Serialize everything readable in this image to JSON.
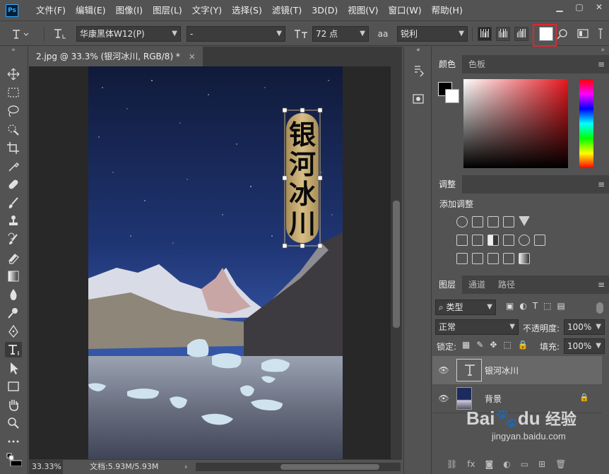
{
  "app": {
    "logo": "Ps",
    "menus": [
      "文件(F)",
      "编辑(E)",
      "图像(I)",
      "图层(L)",
      "文字(Y)",
      "选择(S)",
      "滤镜(T)",
      "3D(D)",
      "视图(V)",
      "窗口(W)",
      "帮助(H)"
    ],
    "window_controls": {
      "minimize": "▁",
      "maximize": "▢",
      "close": "✕"
    }
  },
  "options": {
    "tool_icon": "type-tool-icon",
    "orient_icon": "toggle-orientation-icon",
    "font_family": "华康黑体W12(P)",
    "font_style": "-",
    "size_icon": "font-size-icon",
    "font_size": "72 点",
    "aa_icon": "aa",
    "antialias": "锐利",
    "text_color": "#ffffff"
  },
  "document": {
    "tab_title": "2.jpg @ 33.3% (银河冰川, RGB/8) *",
    "close": "×",
    "image_text": [
      "银",
      "河",
      "冰",
      "川"
    ],
    "zoom": "33.33%",
    "doc_info": "文档:5.93M/5.93M",
    "arrow": "›"
  },
  "panels": {
    "color_tabs": [
      "颜色",
      "色板"
    ],
    "foreground": "#000000",
    "background": "#ffffff",
    "adjust_tab": "调整",
    "adjust_title": "添加调整",
    "layers_tabs": [
      "图层",
      "通道",
      "路径"
    ],
    "filter_kind": "类型",
    "blend_mode": "正常",
    "opacity_label": "不透明度:",
    "opacity_value": "100%",
    "lock_label": "锁定:",
    "fill_label": "填充:",
    "fill_value": "100%",
    "layers": [
      {
        "name": "银河冰川",
        "selected": true
      },
      {
        "name": "背景",
        "selected": false
      }
    ]
  },
  "watermark": {
    "brand": "Bai",
    "brand2": "du",
    "suffix": "经验",
    "url": "jingyan.baidu.com"
  }
}
